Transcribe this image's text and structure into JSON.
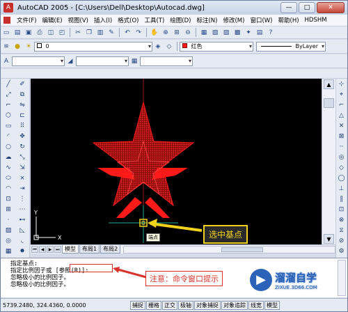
{
  "window": {
    "title": "AutoCAD 2005 - [C:\\Users\\Dell\\Desktop\\Autocad.dwg]",
    "min_label": "—",
    "max_label": "□",
    "close_label": "✕"
  },
  "menu": {
    "items": [
      "文件(F)",
      "编辑(E)",
      "视图(V)",
      "插入(I)",
      "格式(O)",
      "工具(T)",
      "绘图(D)",
      "标注(N)",
      "修改(M)",
      "窗口(W)",
      "帮助(H)",
      "HDSHM"
    ]
  },
  "layers": {
    "layer_value": "0",
    "color_value": "红色",
    "linetype_value": "ByLayer"
  },
  "tabs": [
    "模型",
    "布局1",
    "布局2"
  ],
  "active_tab": "模型",
  "command": {
    "lines": [
      "指定基点:",
      "指定比例因子或 [参照(R)]:",
      "忽略极小的比例因子。",
      "忽略极小的比例因子。"
    ]
  },
  "status": {
    "coords": "5739.2480, 324.4360, 0.0000",
    "buttons": [
      "捕捉",
      "栅格",
      "正交",
      "极轴",
      "对象捕捉",
      "对象追踪",
      "线宽",
      "模型"
    ]
  },
  "annotations": {
    "select_base_point": "选中基点",
    "base_point_tooltip": "端点",
    "note": "注意：命令窗口提示"
  },
  "ucs": {
    "x_label": "X",
    "y_label": "Y"
  },
  "watermark": {
    "title": "溜溜自学",
    "subtitle": "ZIXUE.3D66.COM"
  },
  "colors": {
    "star_red": "#ff1a1a",
    "star_hatch": "#b01010",
    "callout_red": "#d9332c",
    "callout_yellow": "#f1d21a",
    "canvas_bg": "#000000"
  }
}
